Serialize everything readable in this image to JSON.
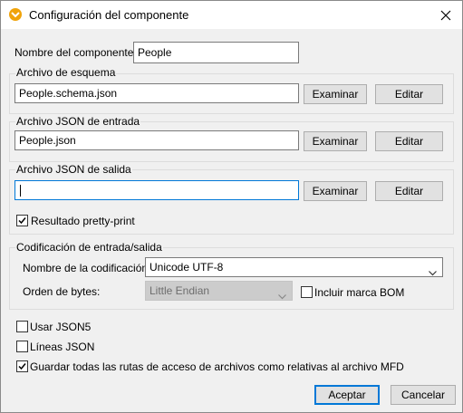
{
  "window": {
    "title": "Configuración del componente",
    "icon": "altova-mapforce-icon",
    "close_icon": "close-icon"
  },
  "component_name": {
    "label": "Nombre del componente:",
    "value": "People"
  },
  "schema_file": {
    "group_label": "Archivo de esquema",
    "value": "People.schema.json",
    "browse_label": "Examinar",
    "edit_label": "Editar"
  },
  "input_file": {
    "group_label": "Archivo JSON de entrada",
    "value": "People.json",
    "browse_label": "Examinar",
    "edit_label": "Editar"
  },
  "output_file": {
    "group_label": "Archivo JSON de salida",
    "value": "",
    "browse_label": "Examinar",
    "edit_label": "Editar",
    "pretty_print_label": "Resultado pretty-print",
    "pretty_print_checked": true
  },
  "encoding": {
    "group_label": "Codificación de entrada/salida",
    "name_label": "Nombre de la codificación:",
    "name_value": "Unicode UTF-8",
    "byte_order_label": "Orden de bytes:",
    "byte_order_value": "Little Endian",
    "bom_label": "Incluir marca BOM",
    "bom_checked": false
  },
  "options": {
    "json5_label": "Usar JSON5",
    "json5_checked": false,
    "json_lines_label": "Líneas JSON",
    "json_lines_checked": false,
    "relative_paths_label": "Guardar todas las rutas de acceso de archivos como relativas al archivo MFD",
    "relative_paths_checked": true
  },
  "footer": {
    "ok_label": "Aceptar",
    "cancel_label": "Cancelar"
  },
  "colors": {
    "accent": "#0078d7",
    "window_bg": "#f0f0f0",
    "icon_orange": "#f0a30a"
  }
}
